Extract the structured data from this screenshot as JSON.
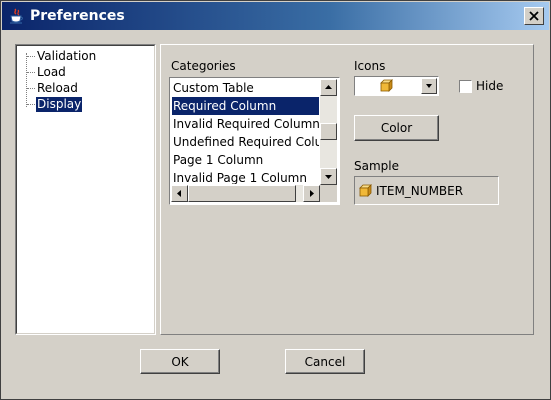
{
  "window": {
    "title": "Preferences"
  },
  "tree": {
    "items": [
      {
        "label": "Validation",
        "selected": false
      },
      {
        "label": "Load",
        "selected": false
      },
      {
        "label": "Reload",
        "selected": false
      },
      {
        "label": "Display",
        "selected": true
      }
    ]
  },
  "categories": {
    "label": "Categories",
    "items": [
      {
        "label": "Custom Table",
        "selected": false
      },
      {
        "label": "Required Column",
        "selected": true
      },
      {
        "label": "Invalid Required Column",
        "selected": false
      },
      {
        "label": "Undefined Required Column",
        "selected": false
      },
      {
        "label": "Page 1 Column",
        "selected": false
      },
      {
        "label": "Invalid Page 1 Column",
        "selected": false
      }
    ]
  },
  "icons": {
    "label": "Icons",
    "selected_icon": "cube-icon",
    "hide_label": "Hide",
    "hide_checked": false
  },
  "color_button": {
    "label": "Color"
  },
  "sample": {
    "label": "Sample",
    "icon": "cube-icon",
    "text": "ITEM_NUMBER"
  },
  "footer": {
    "ok_label": "OK",
    "cancel_label": "Cancel"
  },
  "colors": {
    "selection": "#0a246a",
    "dialog_bg": "#d4d0c8",
    "cube_front": "#f0b838",
    "cube_top": "#f8dc88",
    "cube_side": "#c88a18"
  }
}
